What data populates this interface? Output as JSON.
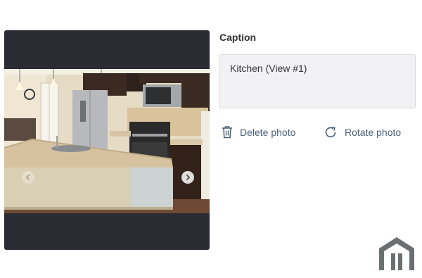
{
  "caption": {
    "label": "Caption",
    "value": "Kitchen (View #1)"
  },
  "actions": {
    "delete_label": "Delete photo",
    "rotate_label": "Rotate photo"
  },
  "icons": {
    "delete": "trash-icon",
    "rotate": "rotate-clockwise-icon",
    "prev": "chevron-left-icon",
    "next": "chevron-right-icon",
    "logo": "house-outline-logo"
  },
  "colors": {
    "viewer_bg": "#2b2c33",
    "action_text": "#4a5f7a",
    "caption_field_bg": "#f2f2f5",
    "logo": "#6a6f72"
  }
}
